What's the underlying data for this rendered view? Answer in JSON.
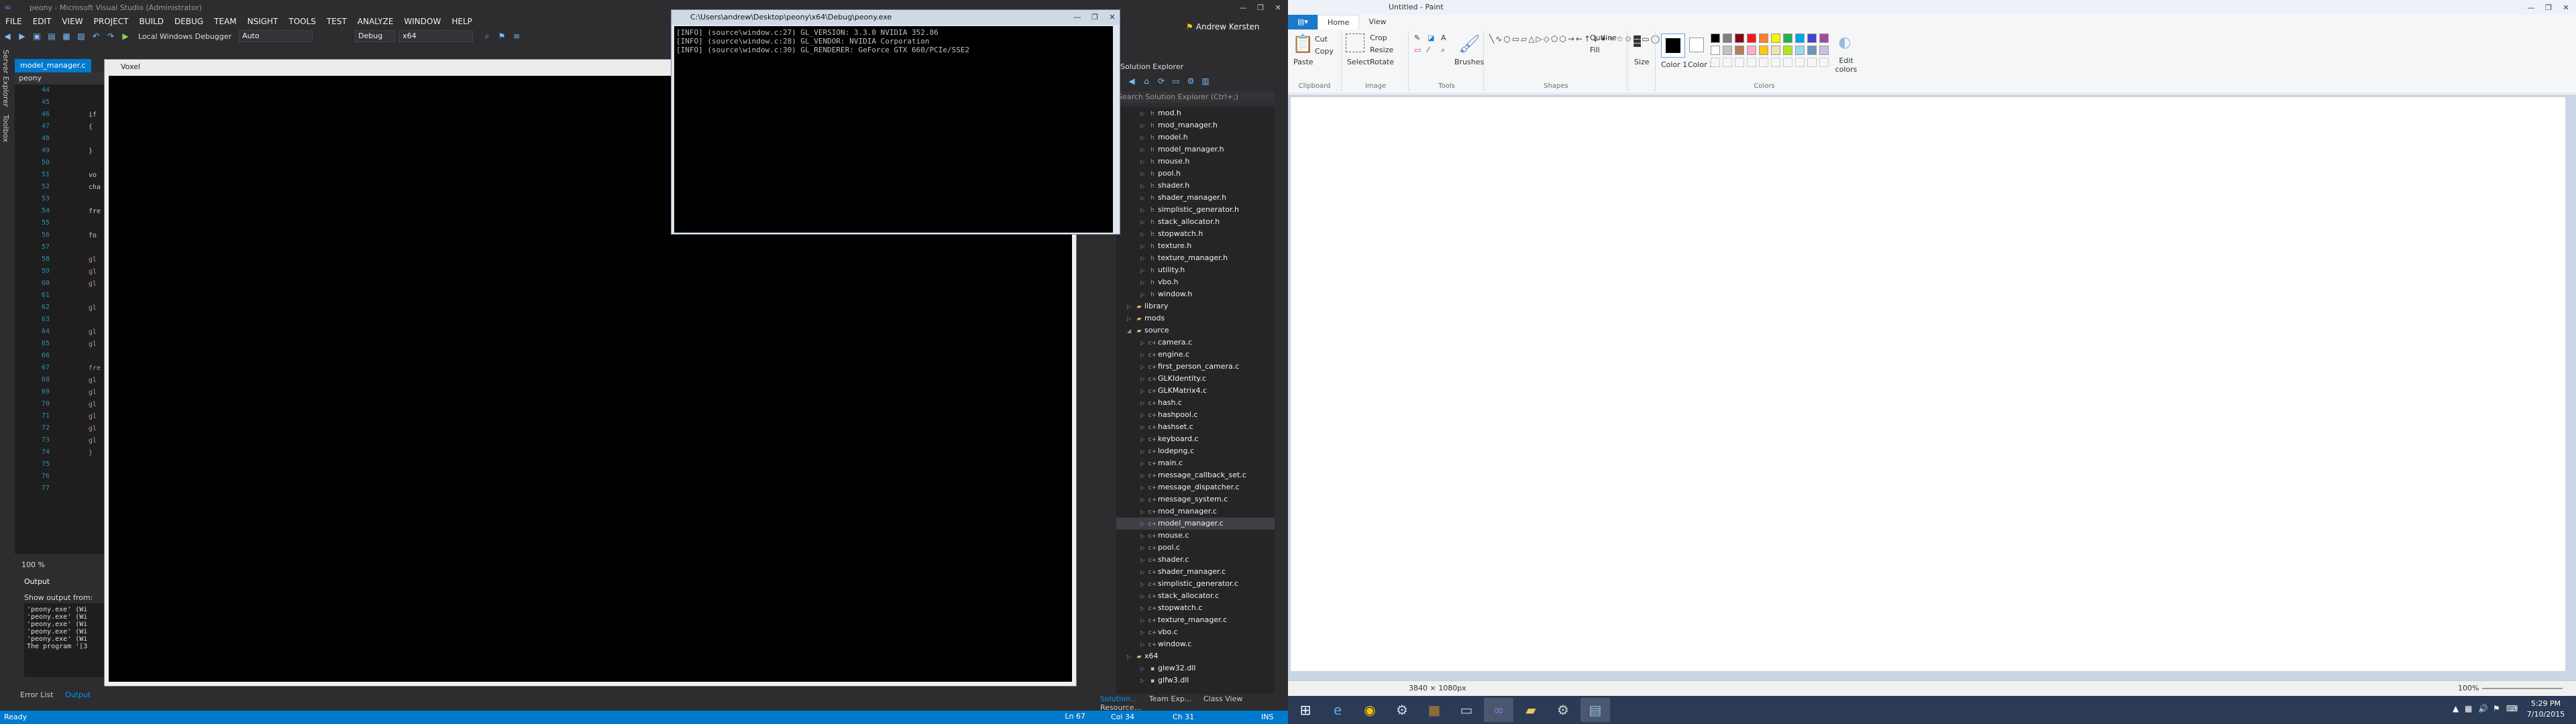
{
  "vs": {
    "title": "peony - Microsoft Visual Studio (Administrator)",
    "menu": [
      "FILE",
      "EDIT",
      "VIEW",
      "PROJECT",
      "BUILD",
      "DEBUG",
      "TEAM",
      "NSIGHT",
      "TOOLS",
      "TEST",
      "ANALYZE",
      "WINDOW",
      "HELP"
    ],
    "toolbar": {
      "debugger": "Local Windows Debugger",
      "auto": "Auto",
      "config": "Debug",
      "platform": "x64"
    },
    "side_tabs": [
      "Server Explorer",
      "Toolbox"
    ],
    "editor": {
      "tab": "model_manager.c",
      "nav": "peony",
      "lines": [
        "44",
        "45",
        "46",
        "47",
        "48",
        "49",
        "50",
        "51",
        "52",
        "53",
        "54",
        "55",
        "56",
        "57",
        "58",
        "59",
        "60",
        "61",
        "62",
        "63",
        "64",
        "65",
        "66",
        "67",
        "68",
        "69",
        "70",
        "71",
        "72",
        "73",
        "74",
        "75",
        "76",
        "77"
      ],
      "frags": [
        "if",
        "{",
        "}",
        "vo",
        "cha",
        "fre",
        "fo",
        "gl",
        "gl",
        "gl",
        "gl",
        "gl",
        "gl",
        "fre",
        "gl",
        "gl",
        "gl",
        "gl",
        "gl",
        "gl",
        "}"
      ],
      "zoom": "100 %"
    },
    "output": {
      "title": "Output",
      "show_from": "Show output from:",
      "lines": [
        "'peony.exe' (Wi",
        "'peony.exe' (Wi",
        "'peony.exe' (Wi",
        "'peony.exe' (Wi",
        "'peony.exe' (Wi",
        "The program '[3"
      ]
    },
    "bottom_tabs": [
      "Error List",
      "Output"
    ],
    "signin": "Andrew Kersten",
    "solution": {
      "header": "Solution Explorer",
      "search": "Search Solution Explorer (Ctrl+;)",
      "items": [
        {
          "t": "h",
          "label": "mod.h"
        },
        {
          "t": "h",
          "label": "mod_manager.h"
        },
        {
          "t": "h",
          "label": "model.h"
        },
        {
          "t": "h",
          "label": "model_manager.h"
        },
        {
          "t": "h",
          "label": "mouse.h"
        },
        {
          "t": "h",
          "label": "pool.h"
        },
        {
          "t": "h",
          "label": "shader.h"
        },
        {
          "t": "h",
          "label": "shader_manager.h"
        },
        {
          "t": "h",
          "label": "simplistic_generator.h"
        },
        {
          "t": "h",
          "label": "stack_allocator.h"
        },
        {
          "t": "h",
          "label": "stopwatch.h"
        },
        {
          "t": "h",
          "label": "texture.h"
        },
        {
          "t": "h",
          "label": "texture_manager.h"
        },
        {
          "t": "h",
          "label": "utility.h"
        },
        {
          "t": "h",
          "label": "vbo.h"
        },
        {
          "t": "h",
          "label": "window.h"
        },
        {
          "t": "folder",
          "label": "library"
        },
        {
          "t": "folder",
          "label": "mods"
        },
        {
          "t": "folder",
          "label": "source"
        },
        {
          "t": "c",
          "label": "camera.c"
        },
        {
          "t": "c",
          "label": "engine.c"
        },
        {
          "t": "c",
          "label": "first_person_camera.c"
        },
        {
          "t": "c",
          "label": "GLKIdentity.c"
        },
        {
          "t": "c",
          "label": "GLKMatrix4.c"
        },
        {
          "t": "c",
          "label": "hash.c"
        },
        {
          "t": "c",
          "label": "hashpool.c"
        },
        {
          "t": "c",
          "label": "hashset.c"
        },
        {
          "t": "c",
          "label": "keyboard.c"
        },
        {
          "t": "c",
          "label": "lodepng.c"
        },
        {
          "t": "c",
          "label": "main.c"
        },
        {
          "t": "c",
          "label": "message_callback_set.c"
        },
        {
          "t": "c",
          "label": "message_dispatcher.c"
        },
        {
          "t": "c",
          "label": "message_system.c"
        },
        {
          "t": "c",
          "label": "mod_manager.c"
        },
        {
          "t": "c",
          "label": "model_manager.c"
        },
        {
          "t": "c",
          "label": "mouse.c"
        },
        {
          "t": "c",
          "label": "pool.c"
        },
        {
          "t": "c",
          "label": "shader.c"
        },
        {
          "t": "c",
          "label": "shader_manager.c"
        },
        {
          "t": "c",
          "label": "simplistic_generator.c"
        },
        {
          "t": "c",
          "label": "stack_allocator.c"
        },
        {
          "t": "c",
          "label": "stopwatch.c"
        },
        {
          "t": "c",
          "label": "texture_manager.c"
        },
        {
          "t": "c",
          "label": "vbo.c"
        },
        {
          "t": "c",
          "label": "window.c"
        },
        {
          "t": "folder",
          "label": "x64"
        },
        {
          "t": "dll",
          "label": "glew32.dll"
        },
        {
          "t": "dll",
          "label": "glfw3.dll"
        }
      ],
      "selected": "model_manager.c",
      "tabs": [
        "Solution...",
        "Team Exp...",
        "Class View",
        "Resource..."
      ]
    },
    "status": {
      "ready": "Ready",
      "ln": "Ln 67",
      "col": "Col 34",
      "ch": "Ch 31",
      "ins": "INS"
    }
  },
  "viewer": {
    "title": "Voxel"
  },
  "console": {
    "title": "C:\\Users\\andrew\\Desktop\\peony\\x64\\Debug\\peony.exe",
    "lines": [
      "[INFO] (source\\window.c:27) GL_VERSION: 3.3.0 NVIDIA 352.86",
      "[INFO] (source\\window.c:28) GL_VENDOR: NVIDIA Corporation",
      "[INFO] (source\\window.c:30) GL_RENDERER: GeForce GTX 660/PCIe/SSE2"
    ]
  },
  "paint": {
    "title": "Untitled - Paint",
    "tabs": [
      "Home",
      "View"
    ],
    "groups": {
      "clipboard": "Clipboard",
      "image": "Image",
      "tools": "Tools",
      "shapes": "Shapes",
      "colors": "Colors"
    },
    "buttons": {
      "paste": "Paste",
      "cut": "Cut",
      "copy": "Copy",
      "select": "Select",
      "crop": "Crop",
      "resize": "Resize",
      "rotate": "Rotate",
      "brushes": "Brushes",
      "outline": "Outline",
      "fill": "Fill",
      "size": "Size",
      "color1": "Color 1",
      "color2": "Color 2",
      "edit_colors": "Edit colors"
    },
    "palette": [
      "#000000",
      "#7f7f7f",
      "#880015",
      "#ed1c24",
      "#ff7f27",
      "#fff200",
      "#22b14c",
      "#00a2e8",
      "#3f48cc",
      "#a349a4",
      "#ffffff",
      "#c3c3c3",
      "#b97a57",
      "#ffaec9",
      "#ffc90e",
      "#efe4b0",
      "#b5e61d",
      "#99d9ea",
      "#7092be",
      "#c8bfe7"
    ],
    "status": {
      "dims": "3840 × 1080px",
      "zoom": "100%"
    }
  },
  "taskbar": {
    "apps": [
      "start-icon",
      "ie-icon",
      "chrome-icon",
      "steam-icon",
      "minecraft-icon",
      "cmd-icon",
      "visual-studio-icon",
      "explorer-icon",
      "settings-icon",
      "paint-icon"
    ],
    "time": "5:29 PM",
    "date": "7/10/2015"
  }
}
